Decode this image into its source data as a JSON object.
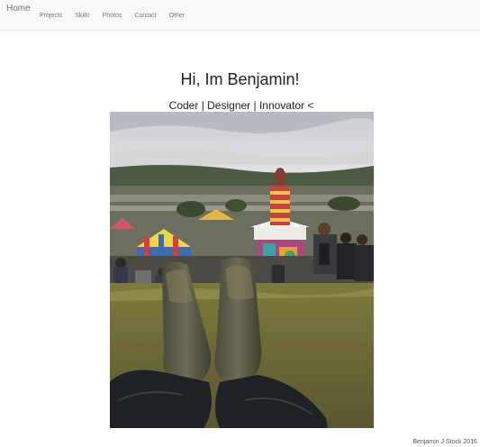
{
  "nav": {
    "brand": "Home",
    "links": [
      "Projects",
      "Skills",
      "Photos",
      "Contact",
      "Other"
    ]
  },
  "hero": {
    "title": "Hi, Im Benjamin!",
    "subtitle": "Coder | Designer | Innovator <"
  },
  "footer": {
    "credit": "Benjamin J Stock 2016"
  }
}
